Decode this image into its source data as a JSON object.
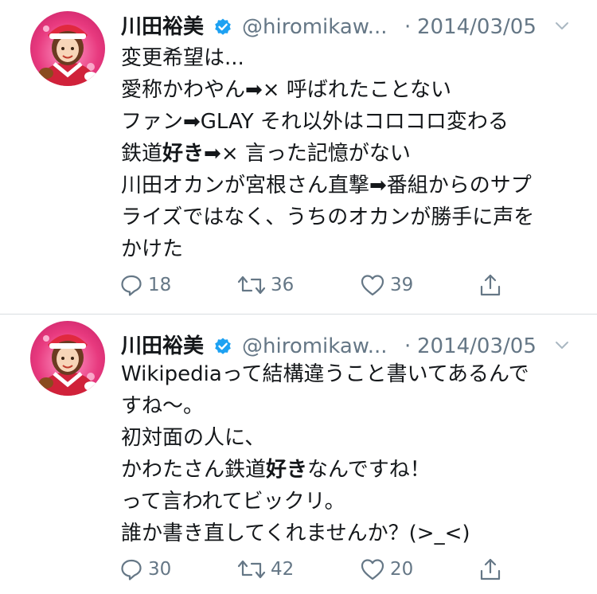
{
  "tweets": [
    {
      "name": "川田裕美",
      "handle": "@hiromikaw...",
      "separator": "·",
      "date": "2014/03/05",
      "lines": [
        [
          "変更希望は..."
        ],
        [
          "愛称かわやん➡× 呼ばれたことない"
        ],
        [
          "ファン➡GLAY それ以外はコロコロ変わる"
        ],
        [
          "鉄道",
          "好き",
          "➡× 言った記憶がない"
        ],
        [
          "川田オカンが宮根さん直撃➡番組からのサプ"
        ],
        [
          "ライズではなく、うちのオカンが勝手に声を"
        ],
        [
          "かけた"
        ]
      ],
      "replies": "18",
      "retweets": "36",
      "likes": "39"
    },
    {
      "name": "川田裕美",
      "handle": "@hiromikaw...",
      "separator": "·",
      "date": "2014/03/05",
      "lines": [
        [
          "Wikipediaって結構違うこと書いてあるんで"
        ],
        [
          "すね〜。"
        ],
        [
          "初対面の人に、"
        ],
        [
          "かわたさん鉄道",
          "好き",
          "なんですね！"
        ],
        [
          "って言われてビックリ。"
        ],
        [
          "誰か書き直してくれませんか？(>_<)"
        ]
      ],
      "replies": "30",
      "retweets": "42",
      "likes": "20"
    }
  ],
  "icons": {
    "verified": "verified-badge-icon",
    "caret": "chevron-down-icon",
    "reply": "reply-icon",
    "retweet": "retweet-icon",
    "like": "heart-icon",
    "share": "share-icon"
  },
  "colors": {
    "text": "#14171a",
    "muted": "#657786",
    "verified": "#1da1f2",
    "divider": "#d8dde1"
  }
}
